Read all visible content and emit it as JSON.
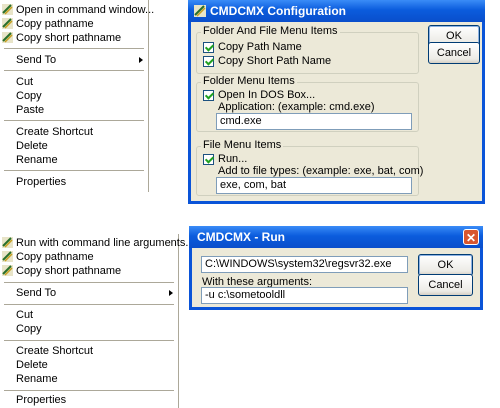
{
  "context_menu_1": {
    "items": [
      {
        "label": "Open in command window...",
        "icon": "command-icon"
      },
      {
        "label": "Copy pathname",
        "icon": "command-icon"
      },
      {
        "label": "Copy short pathname",
        "icon": "command-icon"
      },
      {
        "label": "Send To"
      },
      {
        "label": "Cut"
      },
      {
        "label": "Copy"
      },
      {
        "label": "Paste"
      },
      {
        "label": "Create Shortcut"
      },
      {
        "label": "Delete"
      },
      {
        "label": "Rename"
      },
      {
        "label": "Properties"
      }
    ]
  },
  "config_dialog": {
    "title": "CMDCMX Configuration",
    "ok_label": "OK",
    "cancel_label": "Cancel",
    "group1": {
      "legend": "Folder And File Menu Items",
      "copy_path_label": "Copy Path Name",
      "copy_short_label": "Copy Short Path Name"
    },
    "group2": {
      "legend": "Folder Menu Items",
      "dos_box_label": "Open In DOS Box...",
      "app_label": "Application: (example: cmd.exe)",
      "app_value": "cmd.exe"
    },
    "group3": {
      "legend": "File Menu Items",
      "run_label": "Run...",
      "types_label": "Add to file types: (example: exe, bat, com)",
      "types_value": "exe, com, bat"
    }
  },
  "context_menu_2": {
    "items": [
      {
        "label": "Run with command line arguments...",
        "icon": "command-icon"
      },
      {
        "label": "Copy pathname",
        "icon": "command-icon"
      },
      {
        "label": "Copy short pathname",
        "icon": "command-icon"
      },
      {
        "label": "Send To"
      },
      {
        "label": "Cut"
      },
      {
        "label": "Copy"
      },
      {
        "label": "Create Shortcut"
      },
      {
        "label": "Delete"
      },
      {
        "label": "Rename"
      },
      {
        "label": "Properties"
      }
    ]
  },
  "run_dialog": {
    "title": "CMDCMX - Run",
    "path_value": "C:\\WINDOWS\\system32\\regsvr32.exe",
    "args_label": "With these arguments:",
    "args_value": "-u c:\\sometooldll",
    "ok_label": "OK",
    "cancel_label": "Cancel"
  },
  "colors": {
    "titlebar": "#0b5cdd",
    "dialog_face": "#ece9d8",
    "close_button": "#d8562f"
  }
}
